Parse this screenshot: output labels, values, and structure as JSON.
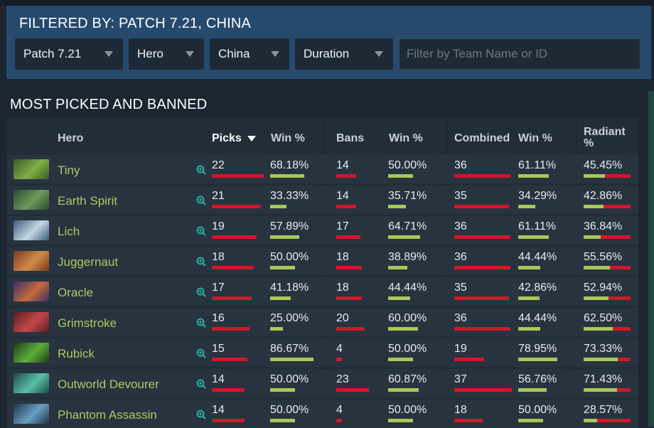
{
  "filter_panel": {
    "title": "FILTERED BY: PATCH 7.21, CHINA",
    "dropdowns": [
      {
        "label": "Patch 7.21"
      },
      {
        "label": "Hero"
      },
      {
        "label": "China"
      },
      {
        "label": "Duration"
      }
    ],
    "search_placeholder": "Filter by Team Name or ID"
  },
  "section_title": "MOST PICKED AND BANNED",
  "table": {
    "headers": {
      "hero": "Hero",
      "picks": "Picks",
      "picks_win": "Win %",
      "bans": "Bans",
      "bans_win": "Win %",
      "combined": "Combined",
      "combined_win": "Win %",
      "radiant_line1": "Radiant",
      "radiant_line2": "%"
    },
    "sorted_by": "picks-descending",
    "colors": {
      "hero_name": "#a8cc62",
      "red_bar": "#d4162a",
      "green_bar": "#a7c95a",
      "accent_icon": "#2aaf9d"
    },
    "rows": [
      {
        "hero": "Tiny",
        "picks": "22",
        "picks_win": "68.18%",
        "bans": "14",
        "bans_win": "50.00%",
        "combined": "36",
        "combined_win": "61.11%",
        "radiant": "45.45%",
        "img": [
          "#3d5a2a",
          "#7fae44"
        ]
      },
      {
        "hero": "Earth Spirit",
        "picks": "21",
        "picks_win": "33.33%",
        "bans": "14",
        "bans_win": "35.71%",
        "combined": "35",
        "combined_win": "34.29%",
        "radiant": "42.86%",
        "img": [
          "#2c4a33",
          "#6c9a5b"
        ]
      },
      {
        "hero": "Lich",
        "picks": "19",
        "picks_win": "57.89%",
        "bans": "17",
        "bans_win": "64.71%",
        "combined": "36",
        "combined_win": "61.11%",
        "radiant": "36.84%",
        "img": [
          "#3b5a7a",
          "#c4d6e4"
        ]
      },
      {
        "hero": "Juggernaut",
        "picks": "18",
        "picks_win": "50.00%",
        "bans": "18",
        "bans_win": "38.89%",
        "combined": "36",
        "combined_win": "44.44%",
        "radiant": "55.56%",
        "img": [
          "#7a3a1e",
          "#d08a4a"
        ]
      },
      {
        "hero": "Oracle",
        "picks": "17",
        "picks_win": "41.18%",
        "bans": "18",
        "bans_win": "44.44%",
        "combined": "35",
        "combined_win": "42.86%",
        "radiant": "52.94%",
        "img": [
          "#3a2e6a",
          "#c46a3a"
        ]
      },
      {
        "hero": "Grimstroke",
        "picks": "16",
        "picks_win": "25.00%",
        "bans": "20",
        "bans_win": "60.00%",
        "combined": "36",
        "combined_win": "44.44%",
        "radiant": "62.50%",
        "img": [
          "#5a1e22",
          "#c2474a"
        ]
      },
      {
        "hero": "Rubick",
        "picks": "15",
        "picks_win": "86.67%",
        "bans": "4",
        "bans_win": "50.00%",
        "combined": "19",
        "combined_win": "78.95%",
        "radiant": "73.33%",
        "img": [
          "#1f3a18",
          "#5fae3a"
        ]
      },
      {
        "hero": "Outworld Devourer",
        "picks": "14",
        "picks_win": "50.00%",
        "bans": "23",
        "bans_win": "60.87%",
        "combined": "37",
        "combined_win": "56.76%",
        "radiant": "71.43%",
        "img": [
          "#1e4a44",
          "#5ac0a8"
        ]
      },
      {
        "hero": "Phantom Assassin",
        "picks": "14",
        "picks_win": "50.00%",
        "bans": "4",
        "bans_win": "50.00%",
        "combined": "18",
        "combined_win": "50.00%",
        "radiant": "28.57%",
        "img": [
          "#1e3448",
          "#6a9ec2"
        ]
      }
    ]
  }
}
